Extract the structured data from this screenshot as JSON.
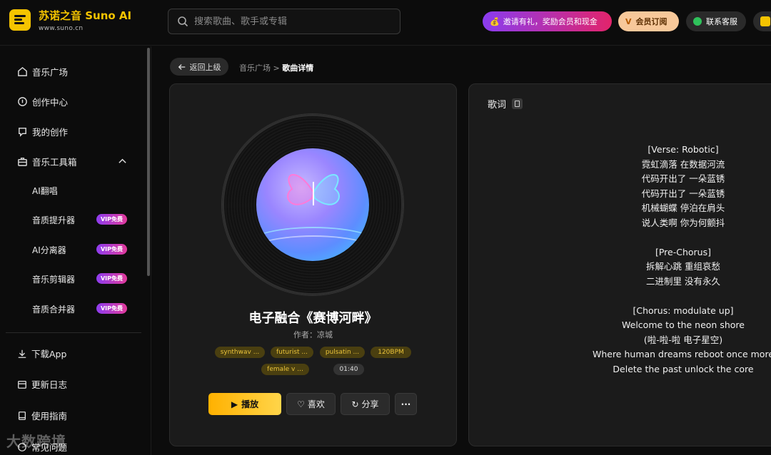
{
  "header": {
    "brand_name": "苏诺之音 Suno AI",
    "brand_url": "www.suno.cn",
    "search_placeholder": "搜索歌曲、歌手或专辑",
    "invite_label": "邀请有礼，奖励会员和现金",
    "vip_label": "会员订阅",
    "service_label": "联系客服"
  },
  "sidebar": {
    "items": [
      {
        "label": "音乐广场",
        "icon": "home-icon"
      },
      {
        "label": "创作中心",
        "icon": "music-disc-icon"
      },
      {
        "label": "我的创作",
        "icon": "heart-chat-icon"
      },
      {
        "label": "音乐工具箱",
        "icon": "toolbox-icon"
      }
    ],
    "tools": [
      {
        "label": "AI翻唱",
        "badge": ""
      },
      {
        "label": "音质提升器",
        "badge": "VIP免费"
      },
      {
        "label": "AI分离器",
        "badge": "VIP免费"
      },
      {
        "label": "音乐剪辑器",
        "badge": "VIP免费"
      },
      {
        "label": "音质合并器",
        "badge": "VIP免费"
      }
    ],
    "bottom": [
      {
        "label": "下载App",
        "icon": "download-icon"
      },
      {
        "label": "更新日志",
        "icon": "calendar-icon"
      },
      {
        "label": "使用指南",
        "icon": "book-icon"
      },
      {
        "label": "常见问题",
        "icon": "question-icon"
      }
    ]
  },
  "nav": {
    "back_label": "返回上级",
    "crumb_parent": "音乐广场",
    "crumb_sep": ">",
    "crumb_current": "歌曲详情"
  },
  "song": {
    "title": "电子融合《赛博河畔》",
    "author": "作者：凉城",
    "tags": [
      "synthwav ...",
      "futurist ...",
      "pulsatin ...",
      "120BPM",
      "female v ..."
    ],
    "duration": "01:40",
    "play_label": "播放",
    "like_label": "喜欢",
    "share_label": "分享",
    "more_label": "···"
  },
  "lyrics": {
    "heading": "歌词",
    "text": "[Verse: Robotic]\n霓虹滴落 在数据河流\n代码开出了 一朵蓝锈\n代码开出了 一朵蓝锈\n机械蝴蝶 停泊在肩头\n说人类啊 你为何颤抖\n\n[Pre-Chorus]\n拆解心跳 重组哀愁\n二进制里 没有永久\n\n[Chorus: modulate up]\nWelcome to the neon shore\n(啦-啦-啦 电子星空)\nWhere human dreams reboot once more\nDelete the past unlock the core"
  },
  "watermark": "大数跨境",
  "colors": {
    "accent": "#f5c400",
    "play_button": "#ffc21a",
    "tag_text": "#e9c23a"
  }
}
